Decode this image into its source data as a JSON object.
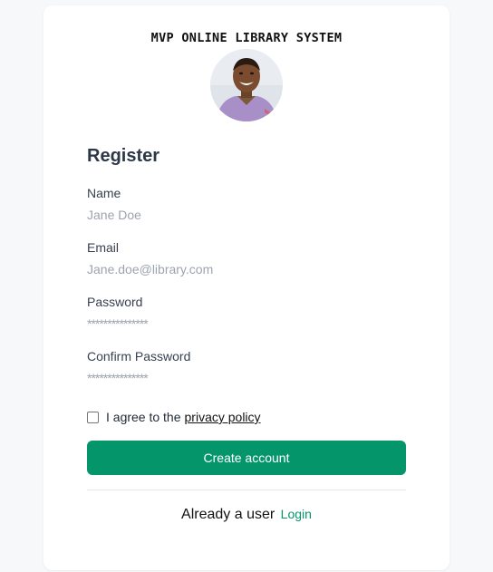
{
  "app": {
    "title": "MVP ONLINE LIBRARY SYSTEM"
  },
  "form": {
    "heading": "Register",
    "name": {
      "label": "Name",
      "placeholder": "Jane Doe",
      "value": ""
    },
    "email": {
      "label": "Email",
      "placeholder": "Jane.doe@library.com",
      "value": ""
    },
    "password": {
      "label": "Password",
      "placeholder": "***************",
      "value": ""
    },
    "confirm_password": {
      "label": "Confirm Password",
      "placeholder": "***************",
      "value": ""
    },
    "agree": {
      "text": "I agree to the",
      "link_text": "privacy policy",
      "checked": false
    },
    "submit_label": "Create account"
  },
  "footer": {
    "prompt": "Already a user",
    "login_label": "Login"
  },
  "colors": {
    "accent": "#04966a",
    "heading": "#2d3748",
    "placeholder": "#9ca3af"
  },
  "icons": {
    "avatar": "user-profile-photo"
  }
}
